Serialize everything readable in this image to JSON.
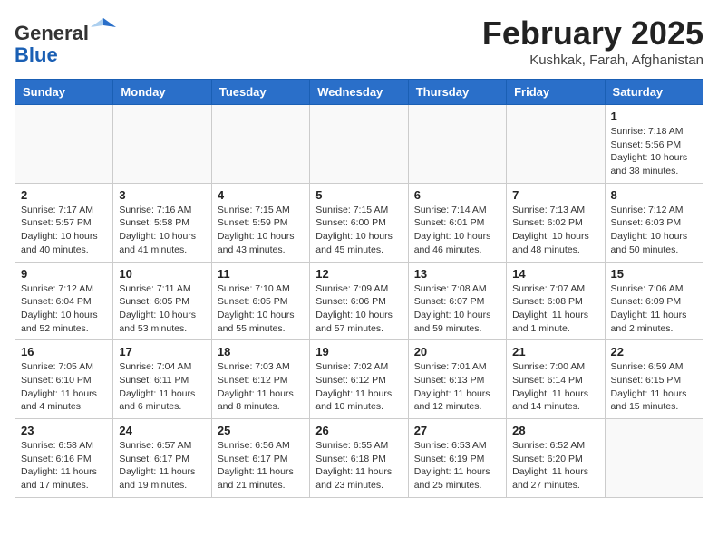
{
  "header": {
    "logo_line1": "General",
    "logo_line2": "Blue",
    "month_title": "February 2025",
    "subtitle": "Kushkak, Farah, Afghanistan"
  },
  "days_of_week": [
    "Sunday",
    "Monday",
    "Tuesday",
    "Wednesday",
    "Thursday",
    "Friday",
    "Saturday"
  ],
  "weeks": [
    [
      {
        "day": "",
        "info": ""
      },
      {
        "day": "",
        "info": ""
      },
      {
        "day": "",
        "info": ""
      },
      {
        "day": "",
        "info": ""
      },
      {
        "day": "",
        "info": ""
      },
      {
        "day": "",
        "info": ""
      },
      {
        "day": "1",
        "info": "Sunrise: 7:18 AM\nSunset: 5:56 PM\nDaylight: 10 hours\nand 38 minutes."
      }
    ],
    [
      {
        "day": "2",
        "info": "Sunrise: 7:17 AM\nSunset: 5:57 PM\nDaylight: 10 hours\nand 40 minutes."
      },
      {
        "day": "3",
        "info": "Sunrise: 7:16 AM\nSunset: 5:58 PM\nDaylight: 10 hours\nand 41 minutes."
      },
      {
        "day": "4",
        "info": "Sunrise: 7:15 AM\nSunset: 5:59 PM\nDaylight: 10 hours\nand 43 minutes."
      },
      {
        "day": "5",
        "info": "Sunrise: 7:15 AM\nSunset: 6:00 PM\nDaylight: 10 hours\nand 45 minutes."
      },
      {
        "day": "6",
        "info": "Sunrise: 7:14 AM\nSunset: 6:01 PM\nDaylight: 10 hours\nand 46 minutes."
      },
      {
        "day": "7",
        "info": "Sunrise: 7:13 AM\nSunset: 6:02 PM\nDaylight: 10 hours\nand 48 minutes."
      },
      {
        "day": "8",
        "info": "Sunrise: 7:12 AM\nSunset: 6:03 PM\nDaylight: 10 hours\nand 50 minutes."
      }
    ],
    [
      {
        "day": "9",
        "info": "Sunrise: 7:12 AM\nSunset: 6:04 PM\nDaylight: 10 hours\nand 52 minutes."
      },
      {
        "day": "10",
        "info": "Sunrise: 7:11 AM\nSunset: 6:05 PM\nDaylight: 10 hours\nand 53 minutes."
      },
      {
        "day": "11",
        "info": "Sunrise: 7:10 AM\nSunset: 6:05 PM\nDaylight: 10 hours\nand 55 minutes."
      },
      {
        "day": "12",
        "info": "Sunrise: 7:09 AM\nSunset: 6:06 PM\nDaylight: 10 hours\nand 57 minutes."
      },
      {
        "day": "13",
        "info": "Sunrise: 7:08 AM\nSunset: 6:07 PM\nDaylight: 10 hours\nand 59 minutes."
      },
      {
        "day": "14",
        "info": "Sunrise: 7:07 AM\nSunset: 6:08 PM\nDaylight: 11 hours\nand 1 minute."
      },
      {
        "day": "15",
        "info": "Sunrise: 7:06 AM\nSunset: 6:09 PM\nDaylight: 11 hours\nand 2 minutes."
      }
    ],
    [
      {
        "day": "16",
        "info": "Sunrise: 7:05 AM\nSunset: 6:10 PM\nDaylight: 11 hours\nand 4 minutes."
      },
      {
        "day": "17",
        "info": "Sunrise: 7:04 AM\nSunset: 6:11 PM\nDaylight: 11 hours\nand 6 minutes."
      },
      {
        "day": "18",
        "info": "Sunrise: 7:03 AM\nSunset: 6:12 PM\nDaylight: 11 hours\nand 8 minutes."
      },
      {
        "day": "19",
        "info": "Sunrise: 7:02 AM\nSunset: 6:12 PM\nDaylight: 11 hours\nand 10 minutes."
      },
      {
        "day": "20",
        "info": "Sunrise: 7:01 AM\nSunset: 6:13 PM\nDaylight: 11 hours\nand 12 minutes."
      },
      {
        "day": "21",
        "info": "Sunrise: 7:00 AM\nSunset: 6:14 PM\nDaylight: 11 hours\nand 14 minutes."
      },
      {
        "day": "22",
        "info": "Sunrise: 6:59 AM\nSunset: 6:15 PM\nDaylight: 11 hours\nand 15 minutes."
      }
    ],
    [
      {
        "day": "23",
        "info": "Sunrise: 6:58 AM\nSunset: 6:16 PM\nDaylight: 11 hours\nand 17 minutes."
      },
      {
        "day": "24",
        "info": "Sunrise: 6:57 AM\nSunset: 6:17 PM\nDaylight: 11 hours\nand 19 minutes."
      },
      {
        "day": "25",
        "info": "Sunrise: 6:56 AM\nSunset: 6:17 PM\nDaylight: 11 hours\nand 21 minutes."
      },
      {
        "day": "26",
        "info": "Sunrise: 6:55 AM\nSunset: 6:18 PM\nDaylight: 11 hours\nand 23 minutes."
      },
      {
        "day": "27",
        "info": "Sunrise: 6:53 AM\nSunset: 6:19 PM\nDaylight: 11 hours\nand 25 minutes."
      },
      {
        "day": "28",
        "info": "Sunrise: 6:52 AM\nSunset: 6:20 PM\nDaylight: 11 hours\nand 27 minutes."
      },
      {
        "day": "",
        "info": ""
      }
    ]
  ]
}
